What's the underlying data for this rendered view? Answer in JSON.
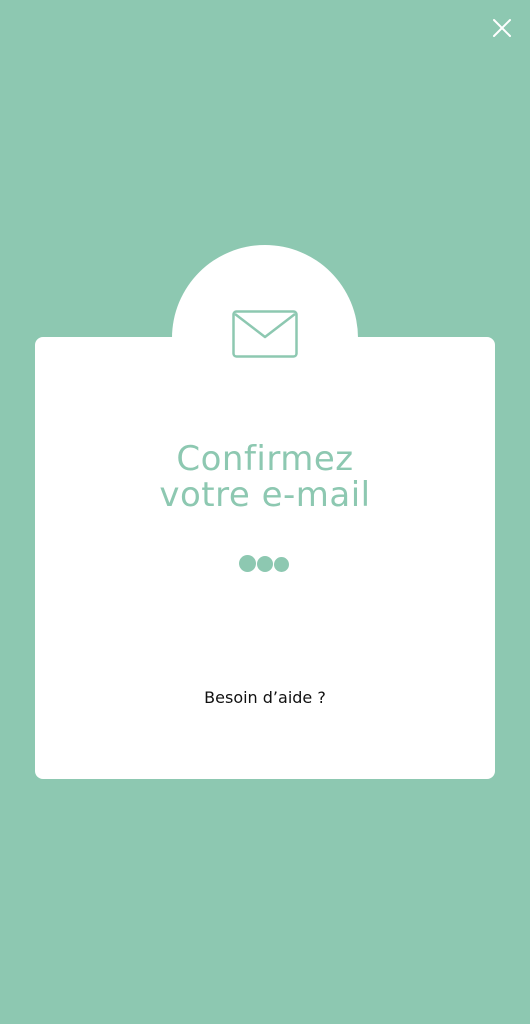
{
  "header": {
    "close_icon": "close-icon"
  },
  "dialog": {
    "icon": "envelope-icon",
    "title_line1": "Confirmez",
    "title_line2": "votre e-mail",
    "loader": "loading-dots",
    "help_link": "Besoin d’aide ?"
  },
  "colors": {
    "background": "#8dc8b1",
    "card": "#ffffff",
    "accent": "#8dc8b1",
    "text_dark": "#111111"
  }
}
